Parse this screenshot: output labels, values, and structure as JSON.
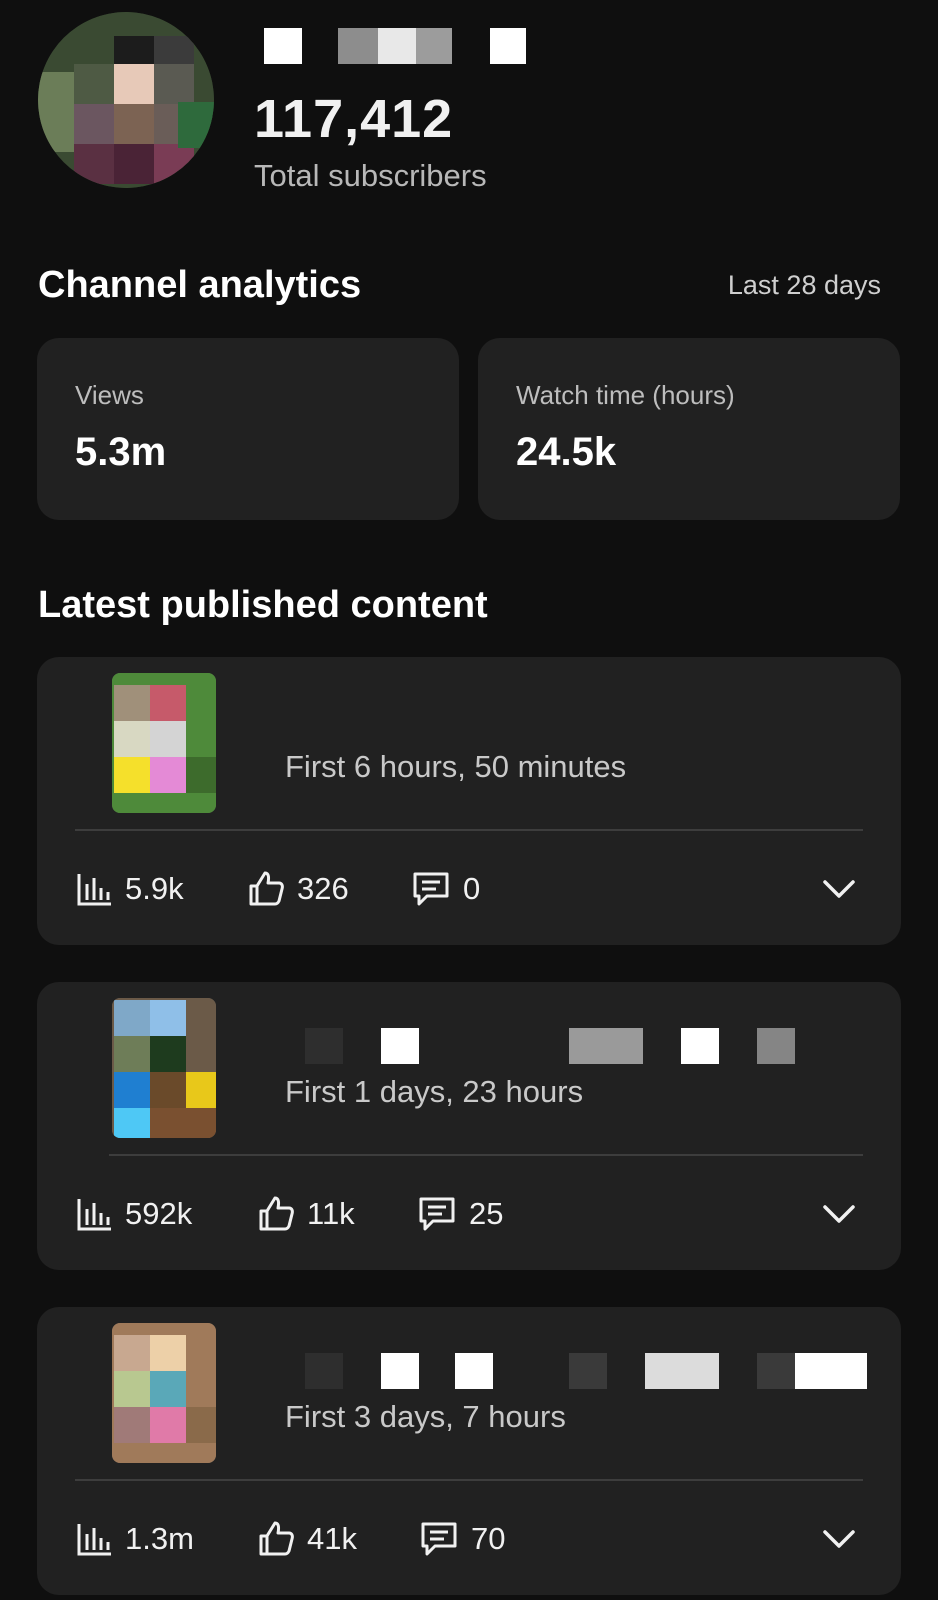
{
  "channel": {
    "subscriber_count": "117,412",
    "subscriber_label": "Total subscribers"
  },
  "analytics": {
    "title": "Channel analytics",
    "period": "Last 28 days",
    "views": {
      "label": "Views",
      "value": "5.3m"
    },
    "watch_time": {
      "label": "Watch time (hours)",
      "value": "24.5k"
    }
  },
  "latest": {
    "title": "Latest published content",
    "items": [
      {
        "time": "First 6 hours, 50 minutes",
        "views": "5.9k",
        "likes": "326",
        "comments": "0"
      },
      {
        "time": "First 1 days, 23 hours",
        "views": "592k",
        "likes": "11k",
        "comments": "25"
      },
      {
        "time": "First 3 days, 7 hours",
        "views": "1.3m",
        "likes": "41k",
        "comments": "70"
      }
    ]
  },
  "icons": {
    "views": "bar-chart-icon",
    "likes": "thumbs-up-icon",
    "comments": "comment-icon",
    "expand": "chevron-down-icon"
  },
  "colors": {
    "background": "#0f0f0f",
    "card": "#212121",
    "text_secondary": "#b8b8b8"
  }
}
